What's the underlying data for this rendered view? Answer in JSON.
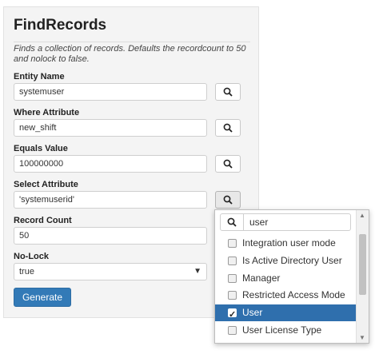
{
  "form": {
    "title": "FindRecords",
    "description": "Finds a collection of records. Defaults the recordcount to 50 and nolock to false.",
    "fields": [
      {
        "label": "Entity Name",
        "value": "systemuser"
      },
      {
        "label": "Where Attribute",
        "value": "new_shift"
      },
      {
        "label": "Equals Value",
        "value": "100000000"
      },
      {
        "label": "Select Attribute",
        "value": "'systemuserid'"
      },
      {
        "label": "Record Count",
        "value": "50"
      }
    ],
    "nolock": {
      "label": "No-Lock",
      "value": "true"
    },
    "generate_label": "Generate"
  },
  "dropdown": {
    "search_value": "user",
    "options": [
      {
        "label": "Integration user mode",
        "checked": false
      },
      {
        "label": "Is Active Directory User",
        "checked": false
      },
      {
        "label": "Manager",
        "checked": false
      },
      {
        "label": "Restricted Access Mode",
        "checked": false
      },
      {
        "label": "User",
        "checked": true
      },
      {
        "label": "User License Type",
        "checked": false
      }
    ]
  },
  "icons": {
    "search": "search-icon",
    "select_arrow": "caret-down-icon",
    "check": "checkmark-icon"
  },
  "colors": {
    "accent": "#337ab7",
    "selected_row": "#2f6fad"
  }
}
